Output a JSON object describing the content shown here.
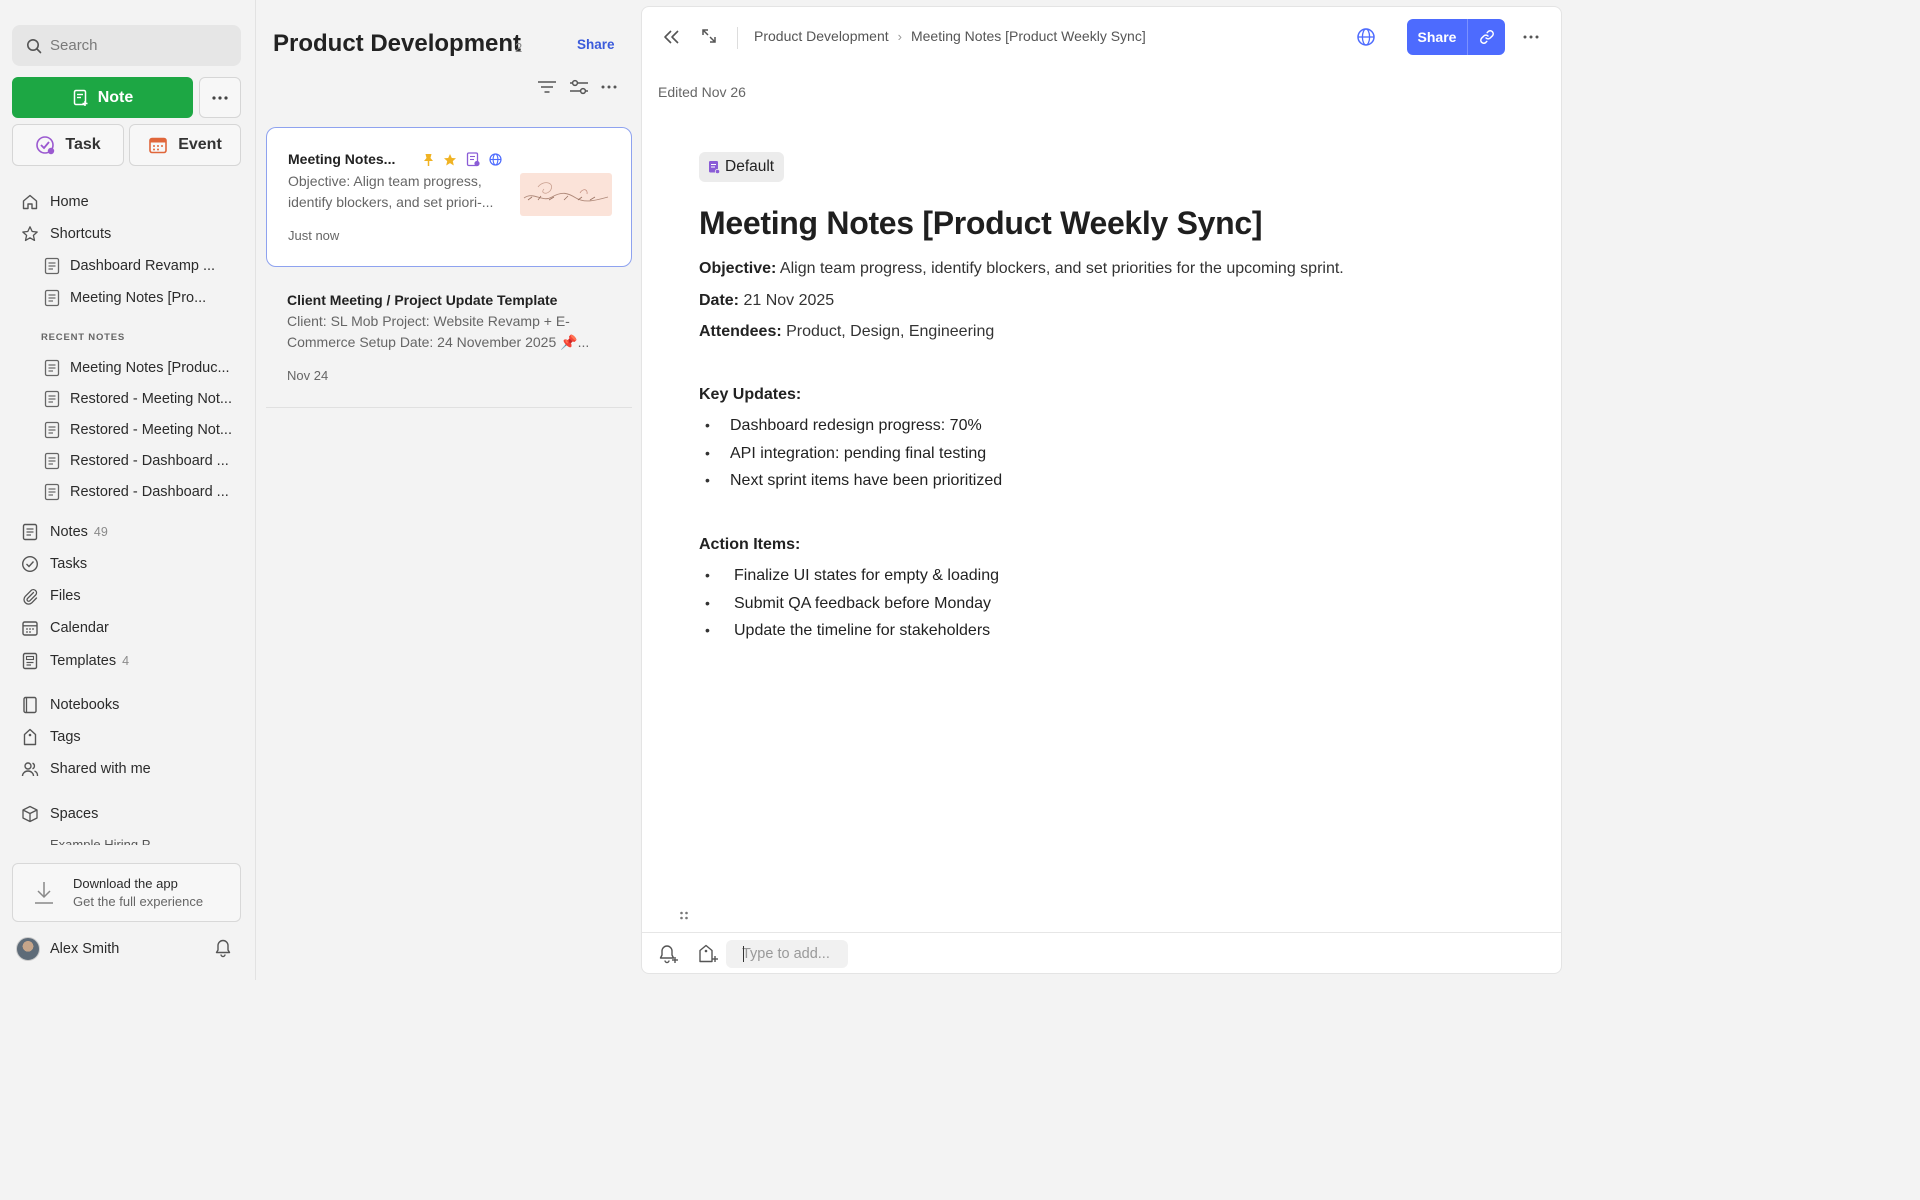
{
  "sidebar": {
    "search_placeholder": "Search",
    "note_button": "Note",
    "task_button": "Task",
    "event_button": "Event",
    "nav": {
      "home": "Home",
      "shortcuts": "Shortcuts",
      "notes": "Notes",
      "notes_count": "49",
      "tasks": "Tasks",
      "files": "Files",
      "calendar": "Calendar",
      "templates": "Templates",
      "templates_count": "4",
      "notebooks": "Notebooks",
      "tags": "Tags",
      "shared": "Shared with me",
      "spaces": "Spaces"
    },
    "shortcut_items": [
      "Dashboard Revamp ...",
      "Meeting Notes [Pro..."
    ],
    "recent_label": "RECENT NOTES",
    "recent_items": [
      "Meeting Notes [Produc...",
      "Restored - Meeting Not...",
      "Restored - Meeting Not...",
      "Restored - Dashboard ...",
      "Restored - Dashboard ..."
    ],
    "spaces_partial": "Example Hiring P...",
    "download_title": "Download the app",
    "download_subtitle": "Get the full experience",
    "user_name": "Alex Smith"
  },
  "notelist": {
    "title": "Product Development",
    "count": "2",
    "share_label": "Share",
    "cards": [
      {
        "title": "Meeting Notes...",
        "snippet": "Objective: Align team progress, identify blockers, and set priori-...",
        "time": "Just now"
      },
      {
        "title": "Client Meeting / Project Update Template",
        "snippet": "Client: SL Mob Project: Website Revamp + E-Commerce Setup Date: 24 November 2025 📌...",
        "time": "Nov 24"
      }
    ]
  },
  "editor": {
    "breadcrumb": [
      "Product Development",
      "Meeting Notes [Product Weekly Sync]"
    ],
    "share_label": "Share",
    "edited": "Edited Nov 26",
    "tag": "Default",
    "title": "Meeting Notes [Product Weekly Sync]",
    "objective_label": "Objective:",
    "objective": " Align team progress, identify blockers, and set priorities for the upcoming sprint.",
    "date_label": "Date:",
    "date": " 21 Nov 2025",
    "attendees_label": "Attendees:",
    "attendees": " Product, Design, Engineering",
    "key_updates_heading": "Key Updates:",
    "key_updates": [
      "Dashboard redesign progress: 70%",
      "API integration: pending final testing",
      "Next sprint items have been prioritized"
    ],
    "action_items_heading": "Action Items:",
    "action_items": [
      "Finalize UI states for empty & loading",
      "Submit QA feedback before Monday",
      "Update the timeline for stakeholders"
    ],
    "type_placeholder": "Type to add..."
  },
  "colors": {
    "note_button": "#1da744",
    "share_button": "#4d6bfe",
    "selected_card_border": "#8ea2ef"
  }
}
